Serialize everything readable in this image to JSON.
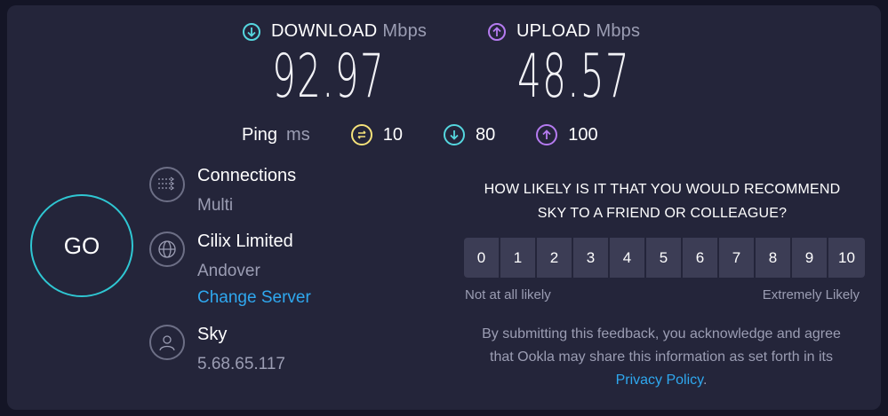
{
  "download": {
    "label": "DOWNLOAD",
    "unit": "Mbps",
    "value": "92.97"
  },
  "upload": {
    "label": "UPLOAD",
    "unit": "Mbps",
    "value": "48.57"
  },
  "ping": {
    "label": "Ping",
    "unit": "ms",
    "idle": "10",
    "download": "80",
    "upload": "100"
  },
  "go_label": "GO",
  "connections": {
    "title": "Connections",
    "value": "Multi"
  },
  "server": {
    "name": "Cilix Limited",
    "location": "Andover",
    "change_label": "Change Server"
  },
  "isp": {
    "name": "Sky",
    "ip": "5.68.65.117"
  },
  "survey": {
    "question_line1": "HOW LIKELY IS IT THAT YOU WOULD RECOMMEND",
    "question_line2": "SKY TO A FRIEND OR COLLEAGUE?",
    "scale": [
      "0",
      "1",
      "2",
      "3",
      "4",
      "5",
      "6",
      "7",
      "8",
      "9",
      "10"
    ],
    "low_label": "Not at all likely",
    "high_label": "Extremely Likely",
    "disclaimer_before": "By submitting this feedback, you acknowledge and agree that Ookla may share this information as set forth in its",
    "privacy_link": "Privacy Policy",
    "disclaimer_after": "."
  },
  "colors": {
    "download": "#55d7df",
    "upload": "#b57bf0",
    "ping": "#f5e27a",
    "link": "#2fa8ef",
    "go_ring": "#2fc7d3"
  }
}
